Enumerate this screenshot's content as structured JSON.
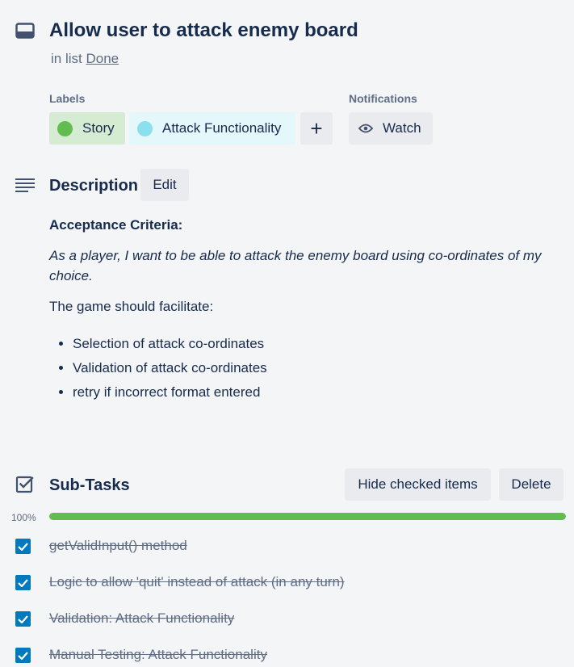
{
  "card": {
    "title": "Allow user to attack enemy board",
    "in_list_prefix": "in list",
    "list_name": "Done"
  },
  "labels": {
    "heading": "Labels",
    "items": [
      {
        "name": "Story",
        "dot_color": "#61bd4f",
        "bg_color": "#d6ecd2"
      },
      {
        "name": "Attack Functionality",
        "dot_color": "#8ce0ee",
        "bg_color": "#e4f7fa"
      }
    ],
    "add_symbol": "+"
  },
  "notifications": {
    "heading": "Notifications",
    "watch_label": "Watch"
  },
  "description": {
    "heading": "Description",
    "edit_label": "Edit",
    "criteria_heading": "Acceptance Criteria:",
    "user_story": "As a player, I want to be able to attack the enemy board using co-ordinates of my choice.",
    "intro": "The game should facilitate:",
    "bullets": [
      "Selection of attack co-ordinates",
      "Validation of attack co-ordinates",
      "retry if incorrect format entered"
    ]
  },
  "checklist": {
    "heading": "Sub-Tasks",
    "hide_checked_label": "Hide checked items",
    "delete_label": "Delete",
    "progress_text": "100%",
    "progress_fraction": 1.0,
    "progress_color": "#61bd4f",
    "items": [
      {
        "text": "getValidInput() method",
        "checked": true
      },
      {
        "text": "Logic to allow 'quit' instead of attack (in any turn)",
        "checked": true
      },
      {
        "text": "Validation: Attack Functionality",
        "checked": true
      },
      {
        "text": "Manual Testing: Attack Functionality",
        "checked": true
      }
    ]
  },
  "icons": {
    "card": "card-icon",
    "description": "description-lines-icon",
    "checklist": "checklist-icon",
    "watch": "eye-icon",
    "check": "checkmark-icon"
  }
}
